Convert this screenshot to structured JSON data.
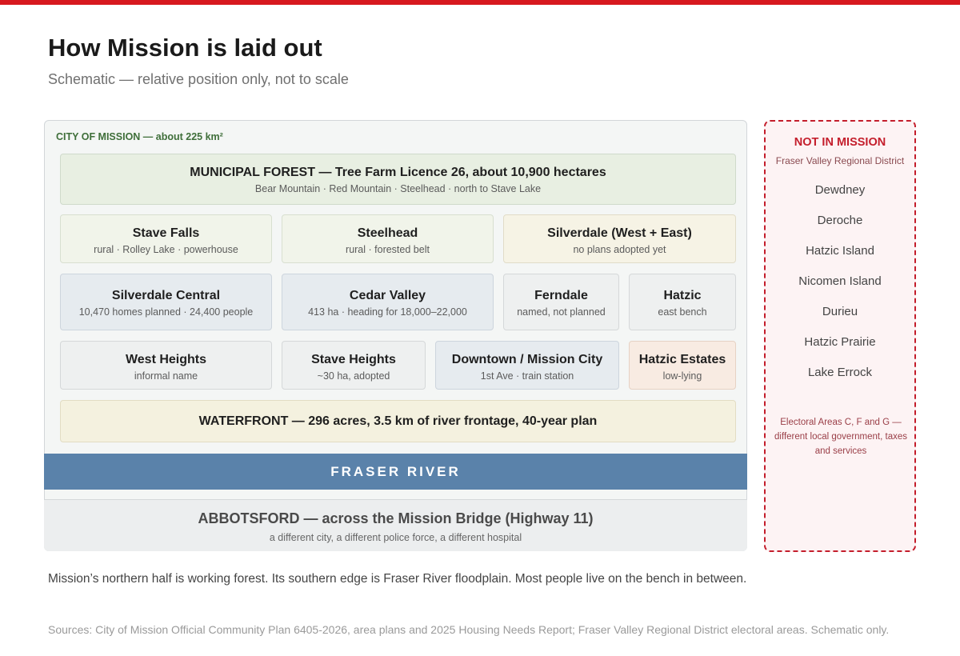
{
  "accent_color": "#d7191f",
  "header": {
    "title": "How Mission is laid out",
    "subtitle": "Schematic — relative position only, not to scale"
  },
  "city": {
    "label": "CITY OF MISSION — about 225 km²",
    "forest": {
      "name": "MUNICIPAL FOREST — Tree Farm Licence 26, about 10,900 hectares",
      "desc": "Bear Mountain · Red Mountain · Steelhead · north to Stave Lake"
    },
    "areas": [
      {
        "name": "Stave Falls",
        "desc": "rural · Rolley Lake · powerhouse"
      },
      {
        "name": "Steelhead",
        "desc": "rural · forested belt"
      },
      {
        "name": "Silverdale (West + East)",
        "desc": "no plans adopted yet"
      },
      {
        "name": "Silverdale Central",
        "desc": "10,470 homes planned · 24,400 people"
      },
      {
        "name": "Cedar Valley",
        "desc": "413 ha · heading for 18,000–22,000"
      },
      {
        "name": "Ferndale",
        "desc": "named, not planned"
      },
      {
        "name": "Hatzic",
        "desc": "east bench"
      },
      {
        "name": "West Heights",
        "desc": "informal name"
      },
      {
        "name": "Stave Heights",
        "desc": "~30 ha, adopted"
      },
      {
        "name": "Downtown / Mission City",
        "desc": "1st Ave · train station"
      },
      {
        "name": "Hatzic Estates",
        "desc": "low-lying"
      }
    ],
    "waterfront": {
      "name": "WATERFRONT — 296 acres, 3.5 km of river frontage, 40-year plan"
    }
  },
  "river": {
    "name": "FRASER RIVER",
    "color": "#5a82aa"
  },
  "abbotsford": {
    "name": "ABBOTSFORD — across the Mission Bridge (Highway 11)",
    "desc": "a different city, a different police force, a different hospital"
  },
  "not_in_mission": {
    "title": "NOT IN MISSION",
    "subtitle": "Fraser Valley Regional District",
    "places": [
      "Dewdney",
      "Deroche",
      "Hatzic Island",
      "Nicomen Island",
      "Durieu",
      "Hatzic Prairie",
      "Lake Errock"
    ],
    "note": "Electoral Areas C, F and G — different local government, taxes and services",
    "color": "#c41e2c"
  },
  "caption": "Mission’s northern half is working forest. Its southern edge is Fraser River floodplain. Most people live on the bench in between.",
  "sources": "Sources: City of Mission Official Community Plan 6405-2026, area plans and 2025 Housing Needs Report; Fraser Valley Regional District electoral areas. Schematic only."
}
